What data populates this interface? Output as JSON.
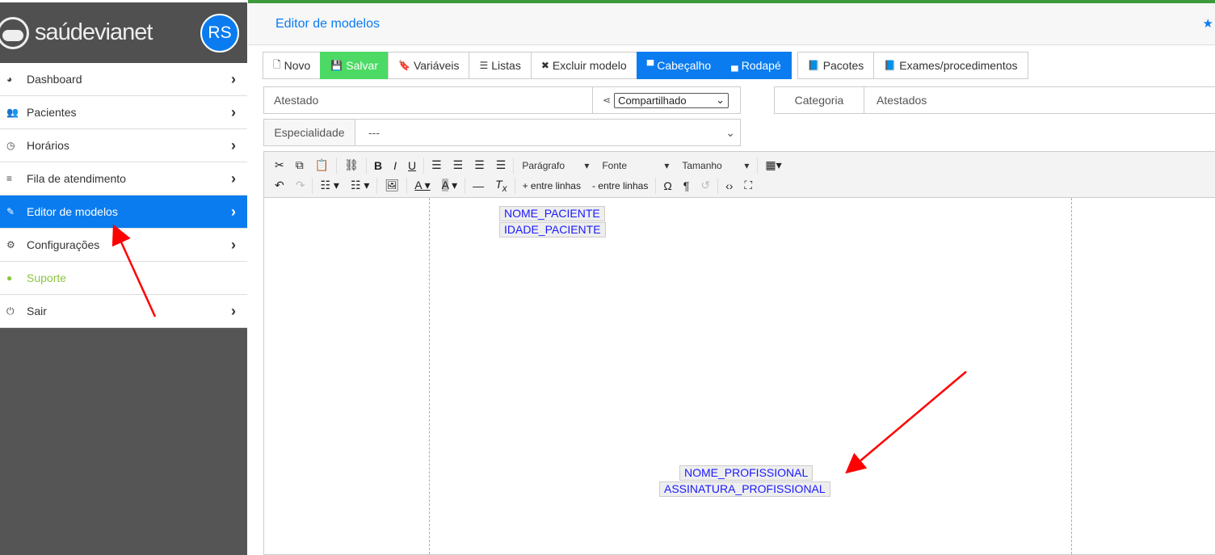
{
  "brand": {
    "name": "saúdevianet",
    "avatar": "RS"
  },
  "sidebar": {
    "items": [
      {
        "label": "Dashboard",
        "icon": "dashboard-icon",
        "glyph": "◕"
      },
      {
        "label": "Pacientes",
        "icon": "users-icon",
        "glyph": "👥"
      },
      {
        "label": "Horários",
        "icon": "clock-icon",
        "glyph": "◷"
      },
      {
        "label": "Fila de atendimento",
        "icon": "list-icon",
        "glyph": "≡"
      },
      {
        "label": "Editor de modelos",
        "icon": "edit-icon",
        "glyph": "✎"
      },
      {
        "label": "Configurações",
        "icon": "gears-icon",
        "glyph": "⚙"
      },
      {
        "label": "Suporte",
        "icon": "chat-icon",
        "glyph": "●"
      },
      {
        "label": "Sair",
        "icon": "power-icon",
        "glyph": "⏻"
      }
    ]
  },
  "header": {
    "title": "Editor de modelos"
  },
  "toolbar": {
    "novo": "Novo",
    "salvar": "Salvar",
    "variaveis": "Variáveis",
    "listas": "Listas",
    "excluir": "Excluir modelo",
    "cabecalho": "Cabeçalho",
    "rodape": "Rodapé",
    "pacotes": "Pacotes",
    "exames": "Exames/procedimentos"
  },
  "form": {
    "nome": "Atestado",
    "compartilhamento": "Compartilhado",
    "categoria_label": "Categoria",
    "categoria": "Atestados",
    "especialidade_label": "Especialidade",
    "especialidade": "---"
  },
  "editor": {
    "paragrafo": "Parágrafo",
    "fonte": "Fonte",
    "tamanho": "Tamanho",
    "mais_linhas": "+ entre linhas",
    "menos_linhas": "- entre linhas",
    "variables": [
      "NOME_PACIENTE",
      "IDADE_PACIENTE",
      "NOME_PROFISSIONAL",
      "ASSINATURA_PROFISSIONAL"
    ]
  }
}
